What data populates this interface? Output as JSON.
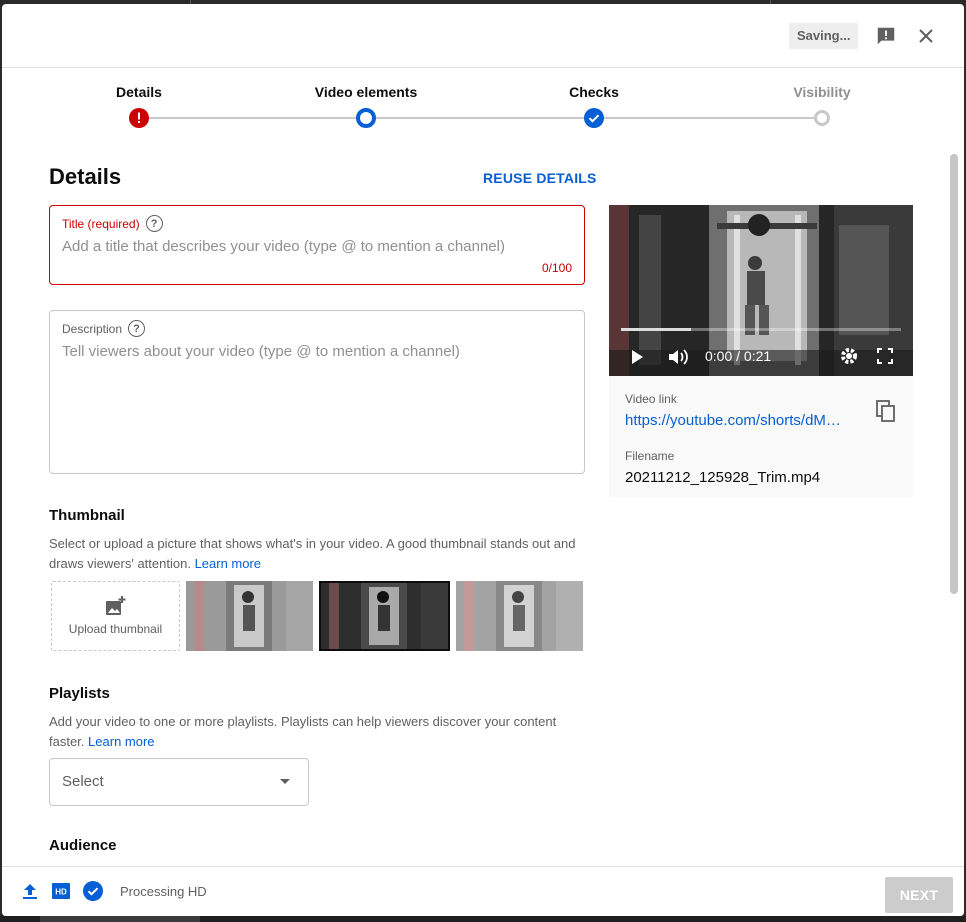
{
  "header": {
    "saving_label": "Saving...",
    "feedback_icon": "feedback-icon",
    "close_icon": "close-icon"
  },
  "stepper": {
    "steps": [
      {
        "label": "Details",
        "state": "error"
      },
      {
        "label": "Video elements",
        "state": "current"
      },
      {
        "label": "Checks",
        "state": "done"
      },
      {
        "label": "Visibility",
        "state": "pending"
      }
    ]
  },
  "details": {
    "heading": "Details",
    "reuse_label": "REUSE DETAILS",
    "title_field": {
      "label": "Title (required)",
      "placeholder": "Add a title that describes your video (type @ to mention a channel)",
      "counter": "0/100"
    },
    "description_field": {
      "label": "Description",
      "placeholder": "Tell viewers about your video (type @ to mention a channel)"
    }
  },
  "thumbnail": {
    "heading": "Thumbnail",
    "text": "Select or upload a picture that shows what's in your video. A good thumbnail stands out and draws viewers' attention.",
    "learn_more": "Learn more",
    "upload_label": "Upload thumbnail",
    "selected_index": 1
  },
  "playlists": {
    "heading": "Playlists",
    "text": "Add your video to one or more playlists. Playlists can help viewers discover your content faster.",
    "learn_more": "Learn more",
    "select_value": "Select"
  },
  "audience": {
    "heading": "Audience"
  },
  "video": {
    "time": "0:00 / 0:21",
    "progress_fraction": 0.25,
    "link_label": "Video link",
    "link_value": "https://youtube.com/shorts/dM…",
    "filename_label": "Filename",
    "filename_value": "20211212_125928_Trim.mp4"
  },
  "footer": {
    "status": "Processing HD",
    "next_label": "NEXT"
  },
  "colors": {
    "accent_blue": "#065fd4",
    "error_red": "#cc0000",
    "check_blue": "#065fd4"
  }
}
